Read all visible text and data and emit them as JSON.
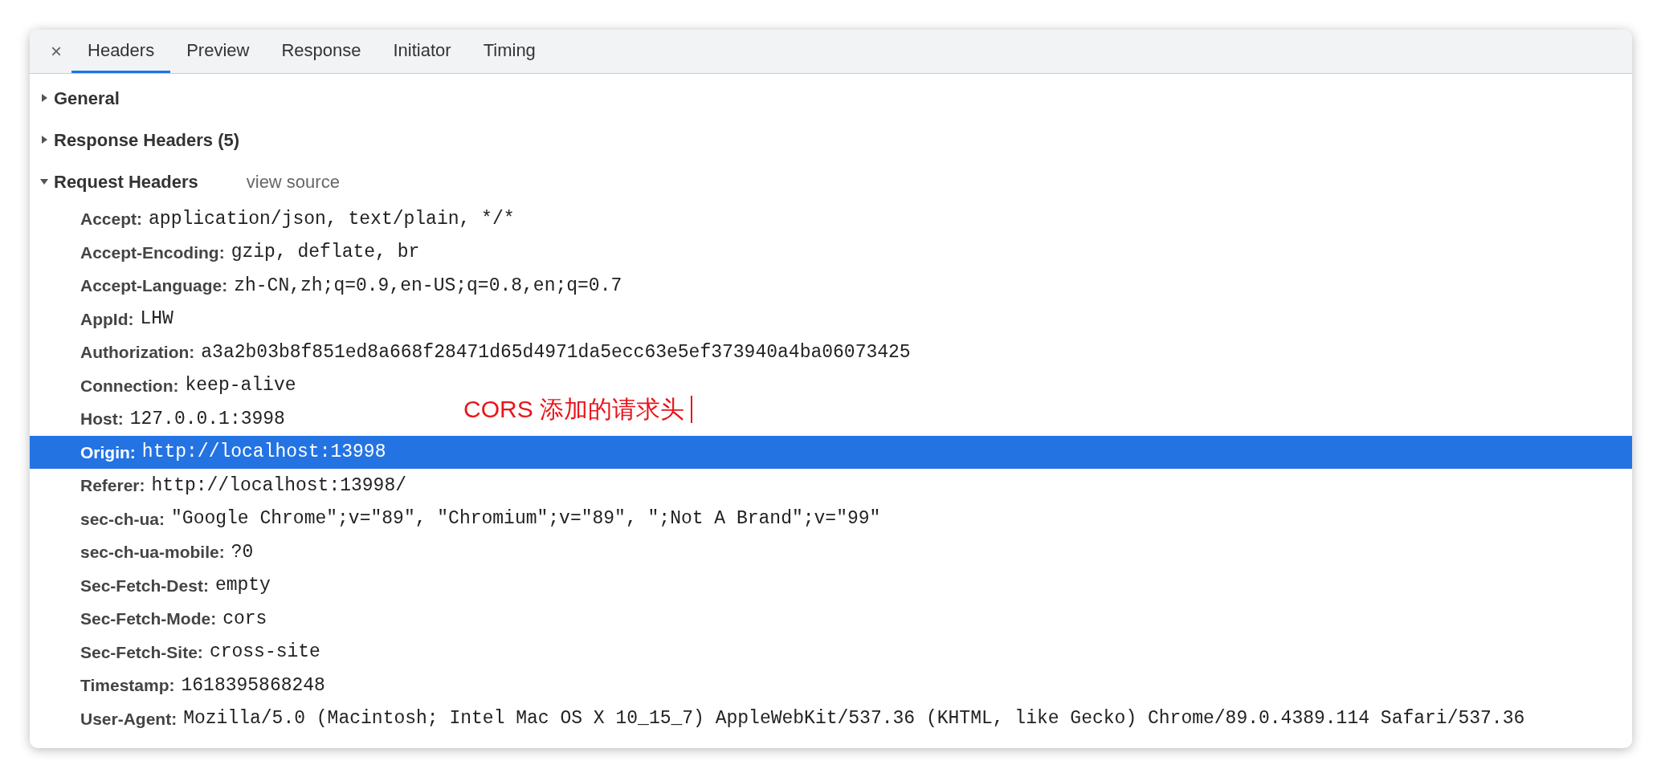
{
  "close_label": "×",
  "tabs": [
    {
      "label": "Headers",
      "selected": true
    },
    {
      "label": "Preview",
      "selected": false
    },
    {
      "label": "Response",
      "selected": false
    },
    {
      "label": "Initiator",
      "selected": false
    },
    {
      "label": "Timing",
      "selected": false
    }
  ],
  "sections": [
    {
      "title": "General",
      "expanded": false
    },
    {
      "title": "Response Headers (5)",
      "expanded": false
    },
    {
      "title": "Request Headers",
      "expanded": true,
      "link": "view source",
      "headers": [
        {
          "name": "Accept:",
          "value": "application/json, text/plain, */*",
          "selected": false
        },
        {
          "name": "Accept-Encoding:",
          "value": "gzip, deflate, br",
          "selected": false
        },
        {
          "name": "Accept-Language:",
          "value": "zh-CN,zh;q=0.9,en-US;q=0.8,en;q=0.7",
          "selected": false
        },
        {
          "name": "AppId:",
          "value": "LHW",
          "selected": false
        },
        {
          "name": "Authorization:",
          "value": "a3a2b03b8f851ed8a668f28471d65d4971da5ecc63e5ef373940a4ba06073425",
          "selected": false
        },
        {
          "name": "Connection:",
          "value": "keep-alive",
          "selected": false
        },
        {
          "name": "Host:",
          "value": "127.0.0.1:3998",
          "selected": false,
          "annotation": "CORS 添加的请求头"
        },
        {
          "name": "Origin:",
          "value": "http://localhost:13998",
          "selected": true
        },
        {
          "name": "Referer:",
          "value": "http://localhost:13998/",
          "selected": false
        },
        {
          "name": "sec-ch-ua:",
          "value": "\"Google Chrome\";v=\"89\", \"Chromium\";v=\"89\", \";Not A Brand\";v=\"99\"",
          "selected": false
        },
        {
          "name": "sec-ch-ua-mobile:",
          "value": "?0",
          "selected": false
        },
        {
          "name": "Sec-Fetch-Dest:",
          "value": "empty",
          "selected": false
        },
        {
          "name": "Sec-Fetch-Mode:",
          "value": "cors",
          "selected": false
        },
        {
          "name": "Sec-Fetch-Site:",
          "value": "cross-site",
          "selected": false
        },
        {
          "name": "Timestamp:",
          "value": "1618395868248",
          "selected": false
        },
        {
          "name": "User-Agent:",
          "value": "Mozilla/5.0 (Macintosh; Intel Mac OS X 10_15_7) AppleWebKit/537.36 (KHTML, like Gecko) Chrome/89.0.4389.114 Safari/537.36",
          "selected": false
        }
      ]
    }
  ]
}
